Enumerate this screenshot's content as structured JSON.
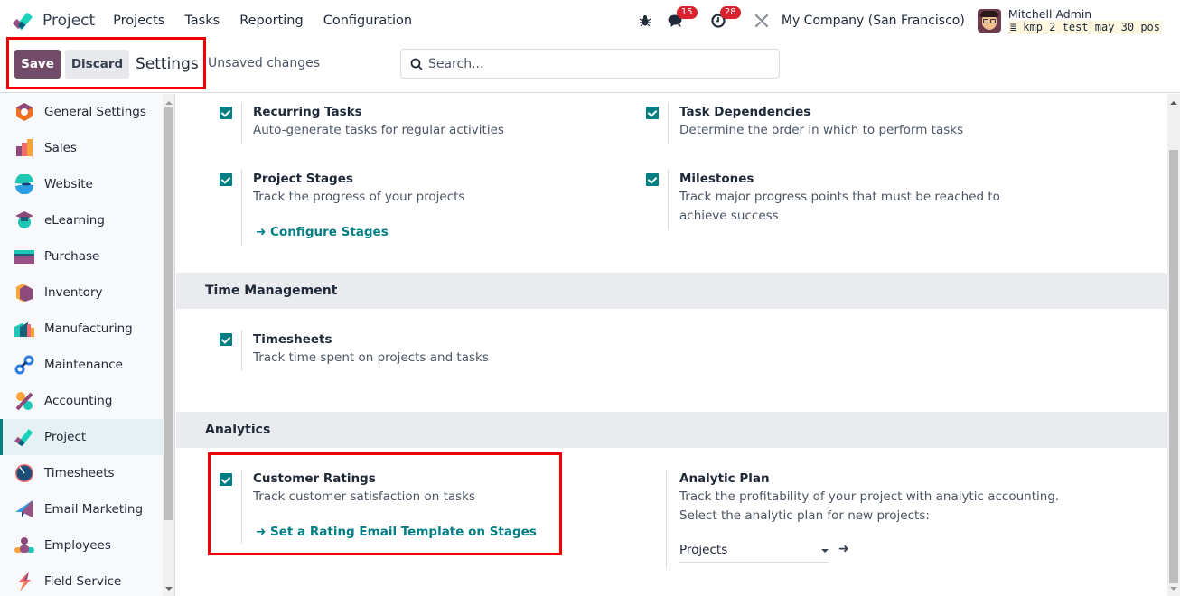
{
  "navbar": {
    "app_name": "Project",
    "menu": [
      "Projects",
      "Tasks",
      "Reporting",
      "Configuration"
    ],
    "messages_count": "15",
    "activities_count": "28",
    "company": "My Company (San Francisco)",
    "user_name": "Mitchell Admin",
    "database": "kmp_2_test_may_30_pos"
  },
  "control": {
    "save_label": "Save",
    "discard_label": "Discard",
    "breadcrumb": "Settings",
    "status": "Unsaved changes",
    "search_placeholder": "Search..."
  },
  "sidebar": {
    "active": "Project",
    "items": [
      {
        "label": "General Settings",
        "icon": "general-settings-icon"
      },
      {
        "label": "Sales",
        "icon": "sales-icon"
      },
      {
        "label": "Website",
        "icon": "website-icon"
      },
      {
        "label": "eLearning",
        "icon": "elearning-icon"
      },
      {
        "label": "Purchase",
        "icon": "purchase-icon"
      },
      {
        "label": "Inventory",
        "icon": "inventory-icon"
      },
      {
        "label": "Manufacturing",
        "icon": "manufacturing-icon"
      },
      {
        "label": "Maintenance",
        "icon": "maintenance-icon"
      },
      {
        "label": "Accounting",
        "icon": "accounting-icon"
      },
      {
        "label": "Project",
        "icon": "project-icon"
      },
      {
        "label": "Timesheets",
        "icon": "timesheets-icon"
      },
      {
        "label": "Email Marketing",
        "icon": "email-marketing-icon"
      },
      {
        "label": "Employees",
        "icon": "employees-icon"
      },
      {
        "label": "Field Service",
        "icon": "field-service-icon"
      }
    ]
  },
  "settings": {
    "recurring_tasks": {
      "title": "Recurring Tasks",
      "desc": "Auto-generate tasks for regular activities",
      "checked": true
    },
    "task_dependencies": {
      "title": "Task Dependencies",
      "desc": "Determine the order in which to perform tasks",
      "checked": true
    },
    "project_stages": {
      "title": "Project Stages",
      "desc": "Track the progress of your projects",
      "link": "Configure Stages",
      "checked": true
    },
    "milestones": {
      "title": "Milestones",
      "desc": "Track major progress points that must be reached to achieve success",
      "checked": true
    },
    "time_management": {
      "heading": "Time Management"
    },
    "timesheets": {
      "title": "Timesheets",
      "desc": "Track time spent on projects and tasks",
      "checked": true
    },
    "analytics": {
      "heading": "Analytics"
    },
    "customer_ratings": {
      "title": "Customer Ratings",
      "desc": "Track customer satisfaction on tasks",
      "link": "Set a Rating Email Template on Stages",
      "checked": true
    },
    "analytic_plan": {
      "title": "Analytic Plan",
      "desc1": "Track the profitability of your project with analytic accounting.",
      "desc2": "Select the analytic plan for new projects:",
      "value": "Projects"
    }
  },
  "colors": {
    "primary": "#714b67",
    "accent": "#017e84",
    "badge": "#d9232e",
    "highlight": "#f20000"
  }
}
